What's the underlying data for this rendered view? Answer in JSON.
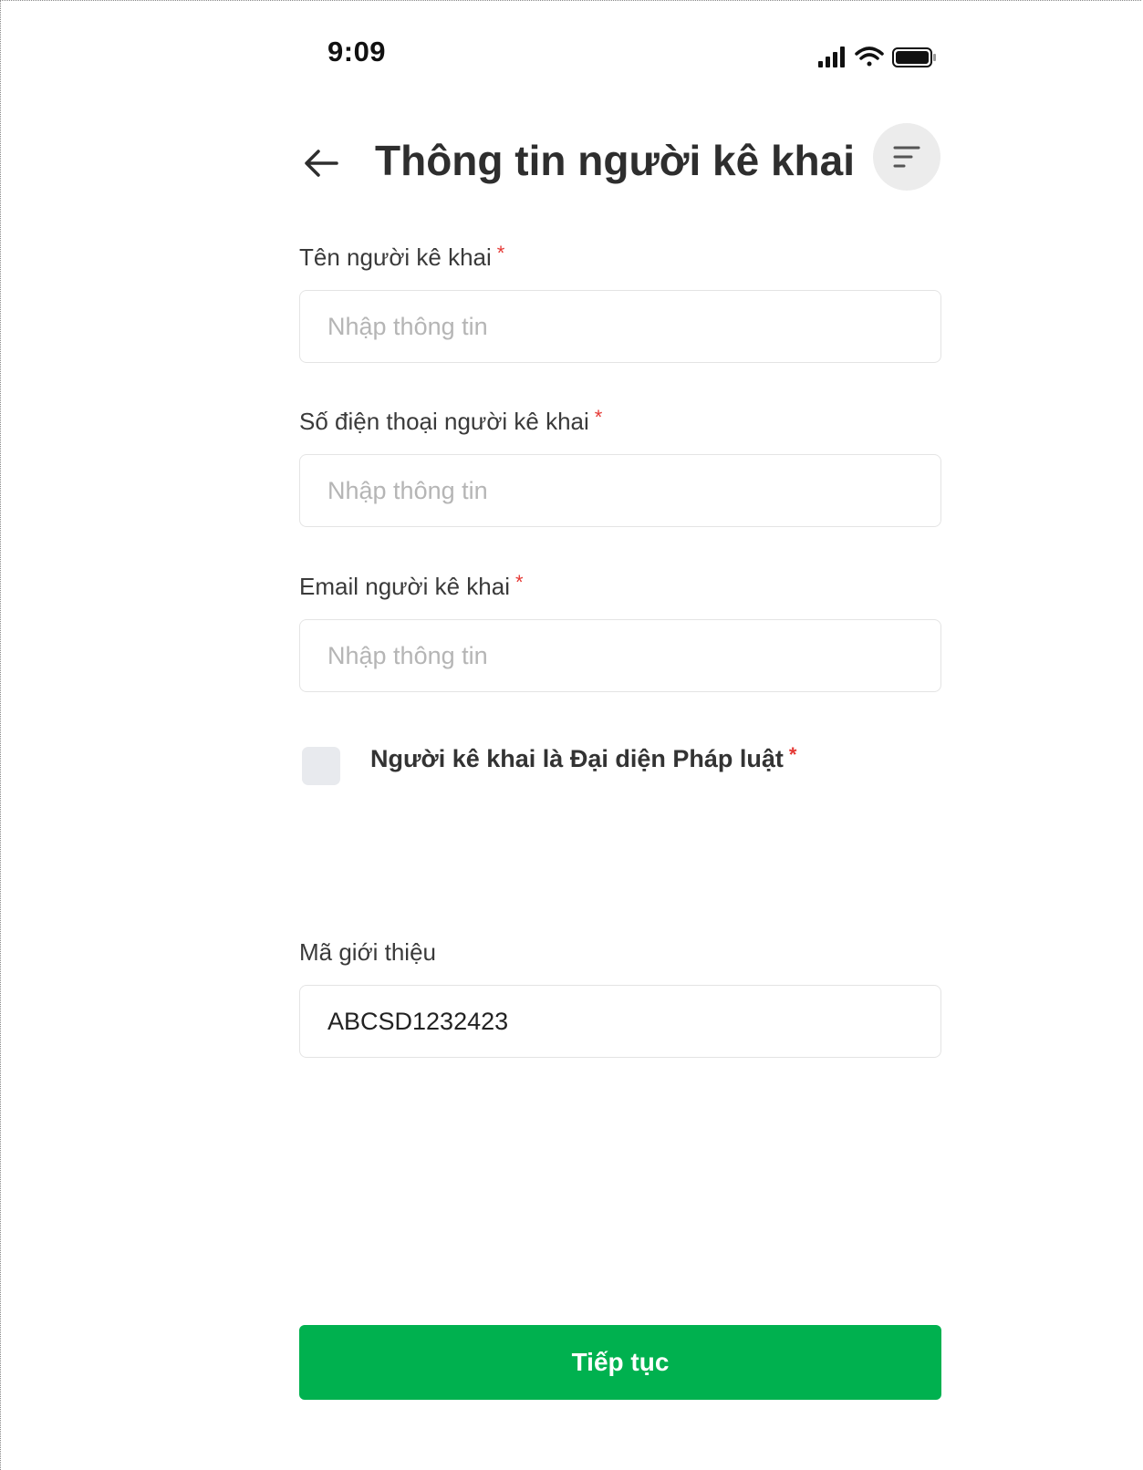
{
  "status_bar": {
    "time": "9:09",
    "icons": [
      "signal-icon",
      "wifi-icon",
      "battery-icon"
    ]
  },
  "header": {
    "title": "Thông tin người kê khai",
    "back_icon": "arrow-left-icon",
    "menu_icon": "sort-lines-icon"
  },
  "form": {
    "name": {
      "label": "Tên người kê khai",
      "required_mark": "*",
      "placeholder": "Nhập thông tin",
      "value": ""
    },
    "phone": {
      "label": "Số điện thoại người kê khai",
      "required_mark": "*",
      "placeholder": "Nhập thông tin",
      "value": ""
    },
    "email": {
      "label": "Email người kê khai",
      "required_mark": "*",
      "placeholder": "Nhập thông tin",
      "value": ""
    },
    "legal_rep": {
      "label": "Người kê khai là Đại diện Pháp luật",
      "required_mark": "*",
      "checked": false
    },
    "referral": {
      "label": "Mã giới thiệu",
      "value": "ABCSD1232423"
    }
  },
  "actions": {
    "continue_label": "Tiếp tục"
  },
  "colors": {
    "primary": "#00B14F",
    "required": "#E53935",
    "placeholder": "#B5B5B5",
    "checkbox_bg": "#E8EAEE",
    "menu_button_bg": "#ECECEC"
  }
}
